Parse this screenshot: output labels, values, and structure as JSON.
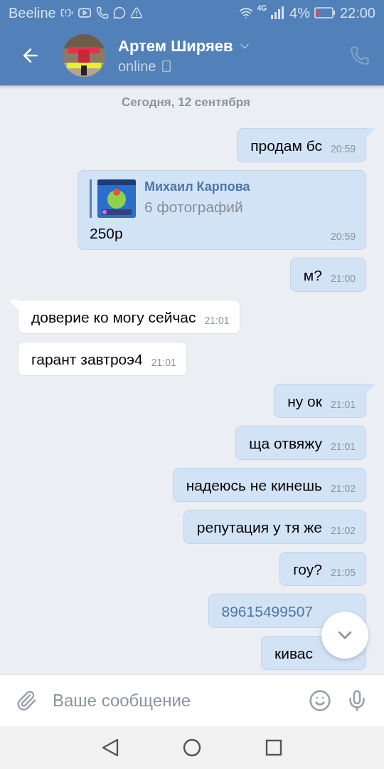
{
  "status_bar": {
    "carrier": "Beeline",
    "network": "4G",
    "battery": "4%",
    "time": "22:00"
  },
  "header": {
    "name": "Артем Ширяев",
    "status": "online"
  },
  "date_label": "Сегодня, 12 сентября",
  "messages": [
    {
      "kind": "text",
      "outgoing": true,
      "tail": true,
      "text": "продам бс",
      "time": "20:59"
    },
    {
      "kind": "forward",
      "author": "Михаил Карпова",
      "attachment": "6 фотографий",
      "text": "250р",
      "time": "20:59"
    },
    {
      "kind": "text",
      "outgoing": true,
      "tail": false,
      "text": "м?",
      "time": "21:00"
    },
    {
      "kind": "text",
      "outgoing": false,
      "tail": true,
      "text": "доверие ко могу сейчас",
      "time": "21:01"
    },
    {
      "kind": "text",
      "outgoing": false,
      "tail": false,
      "text": "гарант завтроэ4",
      "time": "21:01"
    },
    {
      "kind": "text",
      "outgoing": true,
      "tail": true,
      "text": "ну ок",
      "time": "21:01"
    },
    {
      "kind": "text",
      "outgoing": true,
      "tail": false,
      "text": "ща отвяжу",
      "time": "21:01"
    },
    {
      "kind": "text",
      "outgoing": true,
      "tail": false,
      "text": "надеюсь не кинешь",
      "time": "21:02"
    },
    {
      "kind": "text",
      "outgoing": true,
      "tail": false,
      "text": "репутация у тя же",
      "time": "21:02"
    },
    {
      "kind": "text",
      "outgoing": true,
      "tail": false,
      "text": "гоу?",
      "time": "21:05"
    },
    {
      "kind": "link",
      "outgoing": true,
      "tail": false,
      "text": "89615499507"
    },
    {
      "kind": "text",
      "outgoing": true,
      "tail": false,
      "text": "кивас"
    }
  ],
  "composer": {
    "placeholder": "Ваше сообщение"
  }
}
